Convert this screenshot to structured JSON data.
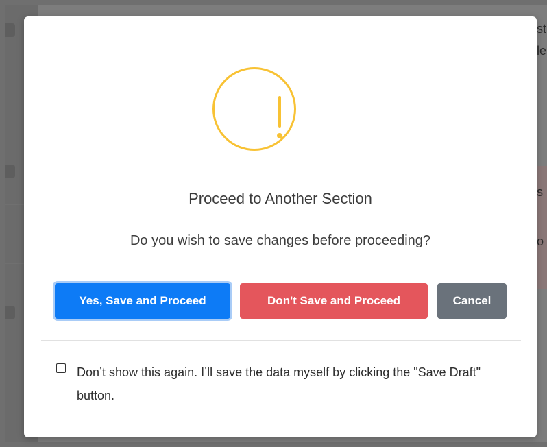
{
  "background": {
    "right_text": [
      "st",
      "le",
      "s",
      "o"
    ]
  },
  "dialog": {
    "icon": "exclamation-warning-icon",
    "icon_color": "#f8c234",
    "title": "Proceed to Another Section",
    "message": "Do you wish to save changes before proceeding?",
    "buttons": {
      "save_label": "Yes, Save and Proceed",
      "dont_save_label": "Don't Save and Proceed",
      "cancel_label": "Cancel"
    },
    "colors": {
      "save": "#0d7bf6",
      "dont_save": "#e4565c",
      "cancel": "#6a727b"
    },
    "dont_show_again": {
      "checked": false,
      "label": "Don’t show this again. I’ll save the data myself by clicking the \"Save Draft\" button."
    }
  }
}
